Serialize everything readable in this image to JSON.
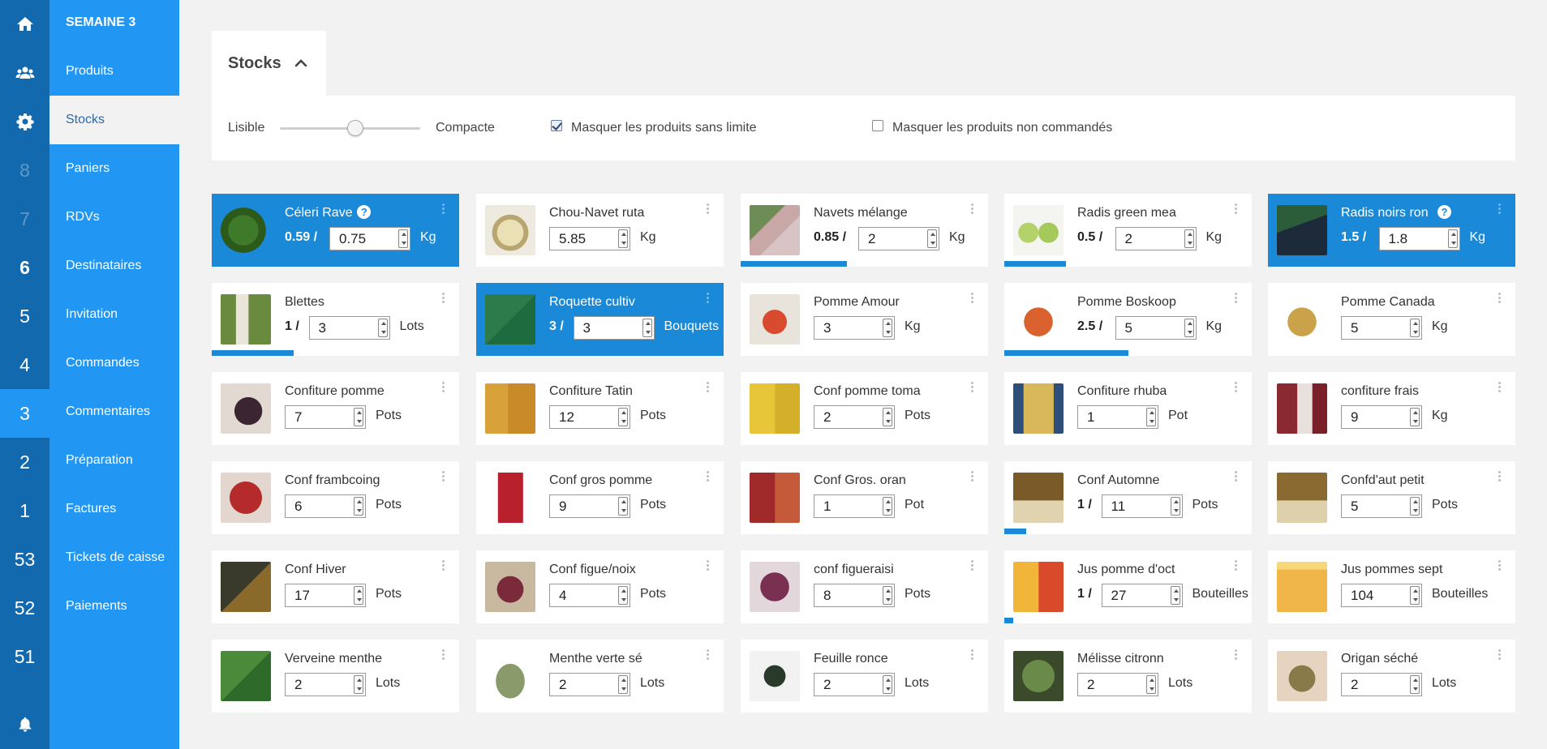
{
  "rail": {
    "numbers": [
      "8",
      "7",
      "6",
      "5",
      "4",
      "3",
      "2",
      "1",
      "53",
      "52",
      "51"
    ]
  },
  "nav": {
    "title": "SEMAINE 3",
    "items": [
      "Produits",
      "Stocks",
      "Paniers",
      "RDVs",
      "Destinataires",
      "Invitation",
      "Commandes",
      "Commentaires",
      "Préparation",
      "Factures",
      "Tickets de caisse",
      "Paiements"
    ],
    "active": "Stocks"
  },
  "section": {
    "title": "Stocks"
  },
  "filters": {
    "readable_label": "Lisible",
    "compact_label": "Compacte",
    "density": 0.55,
    "hide_unlimited_label": "Masquer les produits sans limite",
    "hide_unlimited_checked": true,
    "hide_unordered_label": "Masquer les produits non commandés",
    "hide_unordered_checked": false
  },
  "colors": {
    "rail": "#1269ae",
    "nav": "#2196f3",
    "selected_card": "#1a8ad8",
    "background": "#f2f2f2"
  },
  "products": [
    {
      "name": "Céleri Rave",
      "ordered": "0.59 /",
      "stock": "0.75",
      "unit": "Kg",
      "selected": true,
      "help": "?",
      "progress": 0,
      "img": "celeriac"
    },
    {
      "name": "Chou-Navet ruta",
      "ordered": "",
      "stock": "5.85",
      "unit": "Kg",
      "selected": false,
      "progress": 0,
      "img": "rutabaga"
    },
    {
      "name": "Navets mélange",
      "ordered": "0.85 /",
      "stock": "2",
      "unit": "Kg",
      "selected": false,
      "progress": 0.43,
      "img": "turnips"
    },
    {
      "name": "Radis green mea",
      "ordered": "0.5 /",
      "stock": "2",
      "unit": "Kg",
      "selected": false,
      "progress": 0.25,
      "img": "green-radish"
    },
    {
      "name": "Radis noirs ron",
      "ordered": "1.5 /",
      "stock": "1.8",
      "unit": "Kg",
      "selected": true,
      "help": "?",
      "progress": 0,
      "img": "black-radish"
    },
    {
      "name": "Blettes",
      "ordered": "1 /",
      "stock": "3",
      "unit": "Lots",
      "selected": false,
      "progress": 0.33,
      "img": "chard"
    },
    {
      "name": "Roquette cultiv",
      "ordered": "3 /",
      "stock": "3",
      "unit": "Bouquets",
      "selected": true,
      "progress": 0,
      "img": "rocket"
    },
    {
      "name": "Pomme Amour",
      "ordered": "",
      "stock": "3",
      "unit": "Kg",
      "selected": false,
      "progress": 0,
      "img": "apple-red"
    },
    {
      "name": "Pomme Boskoop",
      "ordered": "2.5 /",
      "stock": "5",
      "unit": "Kg",
      "selected": false,
      "progress": 0.5,
      "img": "apple-boskoop"
    },
    {
      "name": "Pomme Canada",
      "ordered": "",
      "stock": "5",
      "unit": "Kg",
      "selected": false,
      "progress": 0,
      "img": "apple-canada"
    },
    {
      "name": "Confiture pomme",
      "ordered": "",
      "stock": "7",
      "unit": "Pots",
      "selected": false,
      "progress": 0,
      "img": "jam-dark"
    },
    {
      "name": "Confiture Tatin",
      "ordered": "",
      "stock": "12",
      "unit": "Pots",
      "selected": false,
      "progress": 0,
      "img": "jam-jars"
    },
    {
      "name": "Conf pomme toma",
      "ordered": "",
      "stock": "2",
      "unit": "Pots",
      "selected": false,
      "progress": 0,
      "img": "jam-yellow"
    },
    {
      "name": "Confiture rhuba",
      "ordered": "",
      "stock": "1",
      "unit": "Pot",
      "selected": false,
      "progress": 0,
      "img": "jam-rhubarb"
    },
    {
      "name": "confiture frais",
      "ordered": "",
      "stock": "9",
      "unit": "Kg",
      "selected": false,
      "progress": 0,
      "img": "jam-strawberry"
    },
    {
      "name": "Conf frambcoing",
      "ordered": "",
      "stock": "6",
      "unit": "Pots",
      "selected": false,
      "progress": 0,
      "img": "jam-raspberry"
    },
    {
      "name": "Conf gros pomme",
      "ordered": "",
      "stock": "9",
      "unit": "Pots",
      "selected": false,
      "progress": 0,
      "img": "jam-pomegranate"
    },
    {
      "name": "Conf Gros. oran",
      "ordered": "",
      "stock": "1",
      "unit": "Pot",
      "selected": false,
      "progress": 0,
      "img": "jam-orange"
    },
    {
      "name": "Conf Automne",
      "ordered": "1 /",
      "stock": "11",
      "unit": "Pots",
      "selected": false,
      "progress": 0.09,
      "img": "jam-autumn"
    },
    {
      "name": "Confd'aut petit",
      "ordered": "",
      "stock": "5",
      "unit": "Pots",
      "selected": false,
      "progress": 0,
      "img": "jam-autumn-small"
    },
    {
      "name": "Conf Hiver",
      "ordered": "",
      "stock": "17",
      "unit": "Pots",
      "selected": false,
      "progress": 0,
      "img": "jam-winter"
    },
    {
      "name": "Conf figue/noix",
      "ordered": "",
      "stock": "4",
      "unit": "Pots",
      "selected": false,
      "progress": 0,
      "img": "jam-fig"
    },
    {
      "name": "conf figueraisi",
      "ordered": "",
      "stock": "8",
      "unit": "Pots",
      "selected": false,
      "progress": 0,
      "img": "jam-fig-grape"
    },
    {
      "name": "Jus pomme d'oct",
      "ordered": "1 /",
      "stock": "27",
      "unit": "Bouteilles",
      "selected": false,
      "progress": 0.037,
      "img": "juice-apple"
    },
    {
      "name": "Jus pommes sept",
      "ordered": "",
      "stock": "104",
      "unit": "Bouteilles",
      "selected": false,
      "progress": 0,
      "img": "juice-glass"
    },
    {
      "name": "Verveine menthe",
      "ordered": "",
      "stock": "2",
      "unit": "Lots",
      "selected": false,
      "progress": 0,
      "img": "herb-verbena"
    },
    {
      "name": "Menthe verte sé",
      "ordered": "",
      "stock": "2",
      "unit": "Lots",
      "selected": false,
      "progress": 0,
      "img": "herb-mint-dried"
    },
    {
      "name": "Feuille ronce",
      "ordered": "",
      "stock": "2",
      "unit": "Lots",
      "selected": false,
      "progress": 0,
      "img": "herb-bramble-leaf"
    },
    {
      "name": "Mélisse citronn",
      "ordered": "",
      "stock": "2",
      "unit": "Lots",
      "selected": false,
      "progress": 0,
      "img": "herb-lemon-balm"
    },
    {
      "name": "Origan séché",
      "ordered": "",
      "stock": "2",
      "unit": "Lots",
      "selected": false,
      "progress": 0,
      "img": "herb-oregano"
    }
  ]
}
